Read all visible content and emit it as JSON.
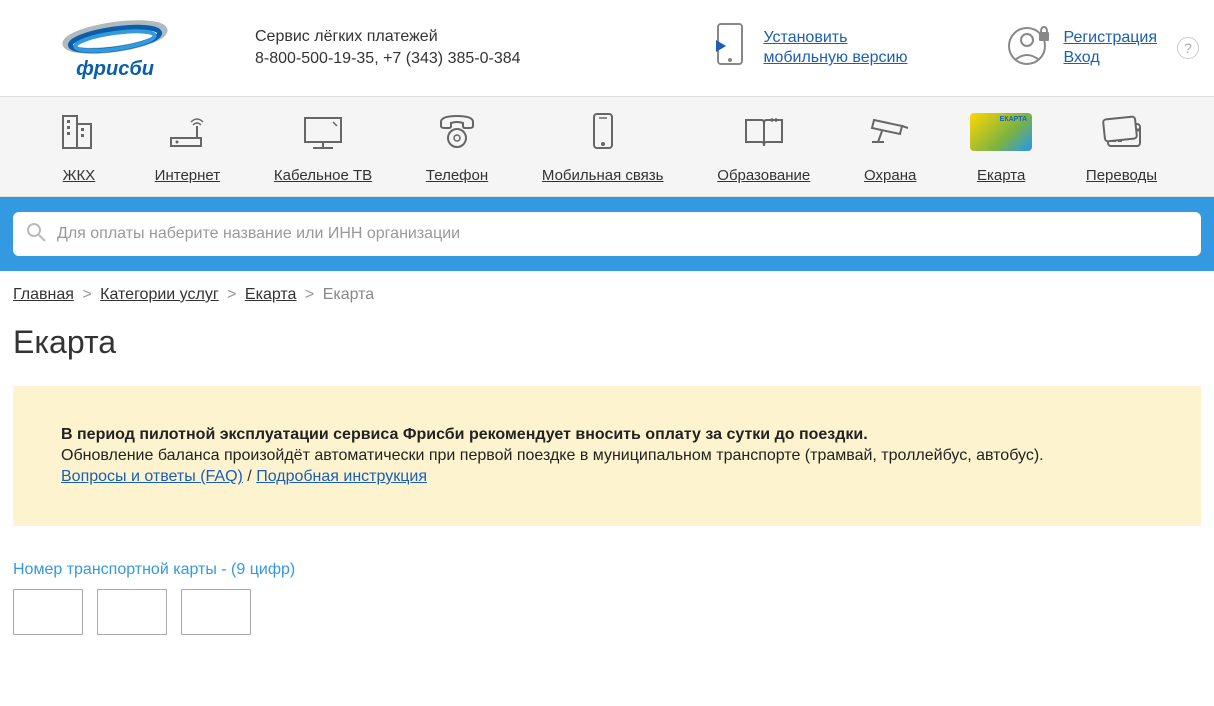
{
  "header": {
    "logo_text": "фрисби",
    "tagline": "Сервис лёгких платежей",
    "phone": "8-800-500-19-35, +7 (343) 385-0-384",
    "mobile_link_1": "Установить",
    "mobile_link_2": "мобильную версию",
    "register_label": "Регистрация",
    "login_label": "Вход",
    "help": "?"
  },
  "nav": {
    "items": [
      {
        "label": "ЖКХ"
      },
      {
        "label": "Интернет"
      },
      {
        "label": "Кабельное ТВ"
      },
      {
        "label": "Телефон"
      },
      {
        "label": "Мобильная связь"
      },
      {
        "label": "Образование"
      },
      {
        "label": "Охрана"
      },
      {
        "label": "Екарта"
      },
      {
        "label": "Переводы"
      }
    ]
  },
  "search": {
    "placeholder": "Для оплаты наберите название или ИНН организации"
  },
  "breadcrumb": {
    "home": "Главная",
    "categories": "Категории услуг",
    "ekarta": "Екарта",
    "current": "Екарта"
  },
  "page": {
    "title": "Екарта"
  },
  "notice": {
    "bold": "В период пилотной эксплуатации сервиса Фрисби рекомендует вносить оплату за сутки до поездки.",
    "text": "Обновление баланса произойдёт автоматически при первой поездке в муниципальном транспорте (трамвай, троллейбус, автобус).",
    "faq": "Вопросы и ответы (FAQ)",
    "sep": " / ",
    "instruction": "Подробная инструкция"
  },
  "card_form": {
    "label": "Номер транспортной карты - (9 цифр)"
  },
  "ekarta_text": "ЕКАРТА"
}
